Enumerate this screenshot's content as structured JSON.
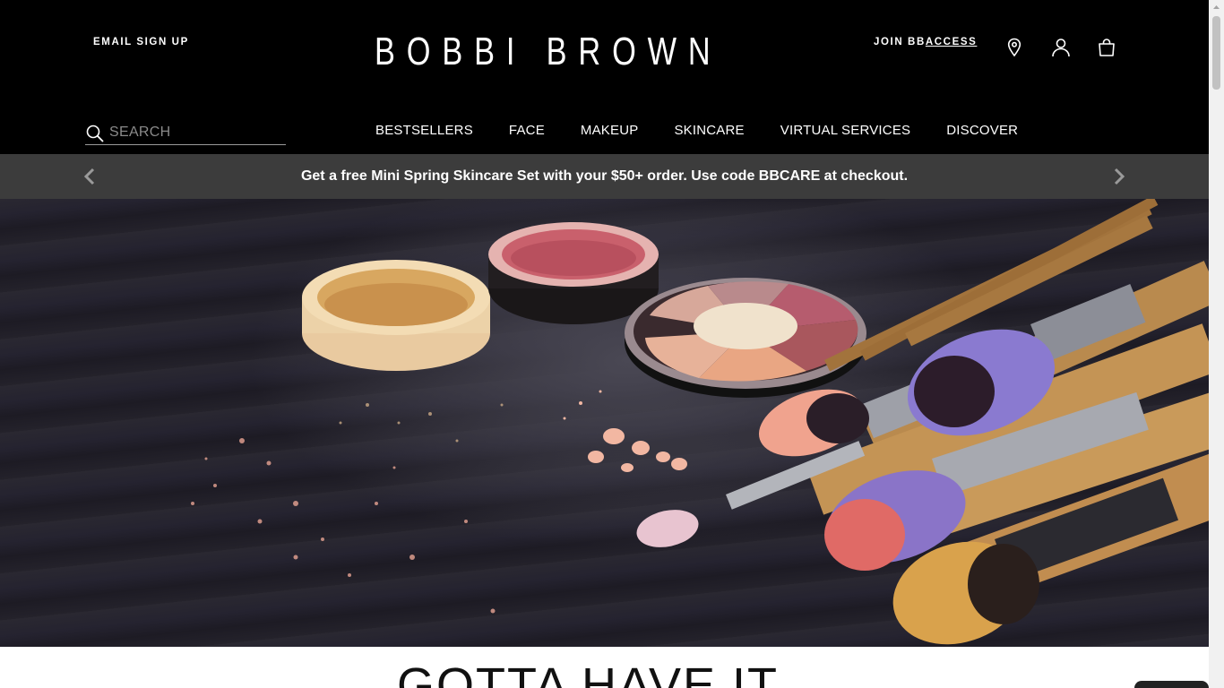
{
  "header": {
    "email_signup": "EMAIL SIGN UP",
    "logo": "BOBBI BROWN",
    "join_prefix": "JOIN BB",
    "join_access": "ACCESS",
    "icons": [
      "location-pin-icon",
      "account-icon",
      "shopping-bag-icon"
    ]
  },
  "search": {
    "placeholder": "SEARCH"
  },
  "nav": {
    "items": [
      "BESTSELLERS",
      "FACE",
      "MAKEUP",
      "SKINCARE",
      "VIRTUAL SERVICES",
      "DISCOVER"
    ]
  },
  "promo": {
    "text": "Get a free Mini Spring Skincare Set with your $50+ order. Use code BBCARE at checkout."
  },
  "section": {
    "title": "GOTTA HAVE IT"
  },
  "colors": {
    "header_bg": "#000000",
    "promo_bg": "#3c3c3c",
    "text_light": "#ffffff"
  }
}
